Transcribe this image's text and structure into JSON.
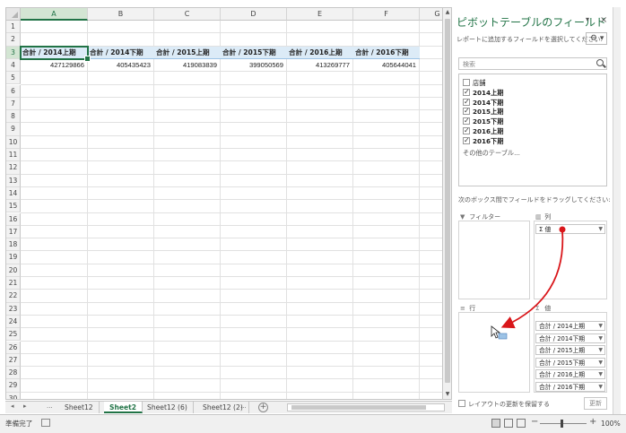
{
  "spreadsheet": {
    "columns": [
      "A",
      "B",
      "C",
      "D",
      "E",
      "F",
      "G"
    ],
    "rows": [
      "1",
      "2",
      "3",
      "4",
      "5",
      "6",
      "7",
      "8",
      "9",
      "10",
      "11",
      "12",
      "13",
      "14",
      "15",
      "16",
      "17",
      "18",
      "19",
      "20",
      "21",
      "22",
      "23",
      "24",
      "25",
      "26",
      "27",
      "28",
      "29",
      "30"
    ],
    "pivot_headers": [
      "合計 / 2014上期",
      "合計 / 2014下期",
      "合計 / 2015上期",
      "合計 / 2015下期",
      "合計 / 2016上期",
      "合計 / 2016下期"
    ],
    "pivot_values": [
      "427129866",
      "405435423",
      "419083839",
      "399050569",
      "413269777",
      "405644041"
    ]
  },
  "sheet_tabs": {
    "nav_prev": "◂",
    "nav_next": "▸",
    "ellipsis_left": "...",
    "tabs": [
      "Sheet12",
      "Sheet2",
      "Sheet12 (6)",
      "Sheet12 (2)"
    ],
    "active_tab": "Sheet2",
    "ellipsis_right": "...",
    "add": "+"
  },
  "status_bar": {
    "ready": "準備完了",
    "zoom": "100%",
    "zoom_minus": "−",
    "zoom_plus": "+"
  },
  "field_pane": {
    "title": "ピボットテーブルのフィールド",
    "menu_icon": "▾",
    "close_icon": "×",
    "choose_hint": "レポートに追加するフィールドを選択してください:",
    "gear": "⚙ ▾",
    "search_placeholder": "検索",
    "fields": [
      {
        "label": "店舗",
        "checked": false
      },
      {
        "label": "2014上期",
        "checked": true
      },
      {
        "label": "2014下期",
        "checked": true
      },
      {
        "label": "2015上期",
        "checked": true
      },
      {
        "label": "2015下期",
        "checked": true
      },
      {
        "label": "2016上期",
        "checked": true
      },
      {
        "label": "2016下期",
        "checked": true
      }
    ],
    "more_tables": "その他のテーブル...",
    "drag_hint": "次のボックス間でフィールドをドラッグしてください:",
    "areas": {
      "filter": {
        "label": "フィルター",
        "icon": "▼"
      },
      "columns": {
        "label": "列",
        "icon": "▥",
        "items": [
          "Σ 値"
        ]
      },
      "rows": {
        "label": "行",
        "icon": "≡",
        "items": []
      },
      "values": {
        "label": "値",
        "icon": "Σ",
        "items": [
          "合計 / 2014上期",
          "合計 / 2014下期",
          "合計 / 2015上期",
          "合計 / 2015下期",
          "合計 / 2016上期",
          "合計 / 2016下期"
        ]
      }
    },
    "defer_update": "レイアウトの更新を保留する",
    "update_button": "更新"
  },
  "colors": {
    "excel_green": "#217346",
    "header_blue": "#dcebf7",
    "arrow_red": "#d9161a"
  }
}
